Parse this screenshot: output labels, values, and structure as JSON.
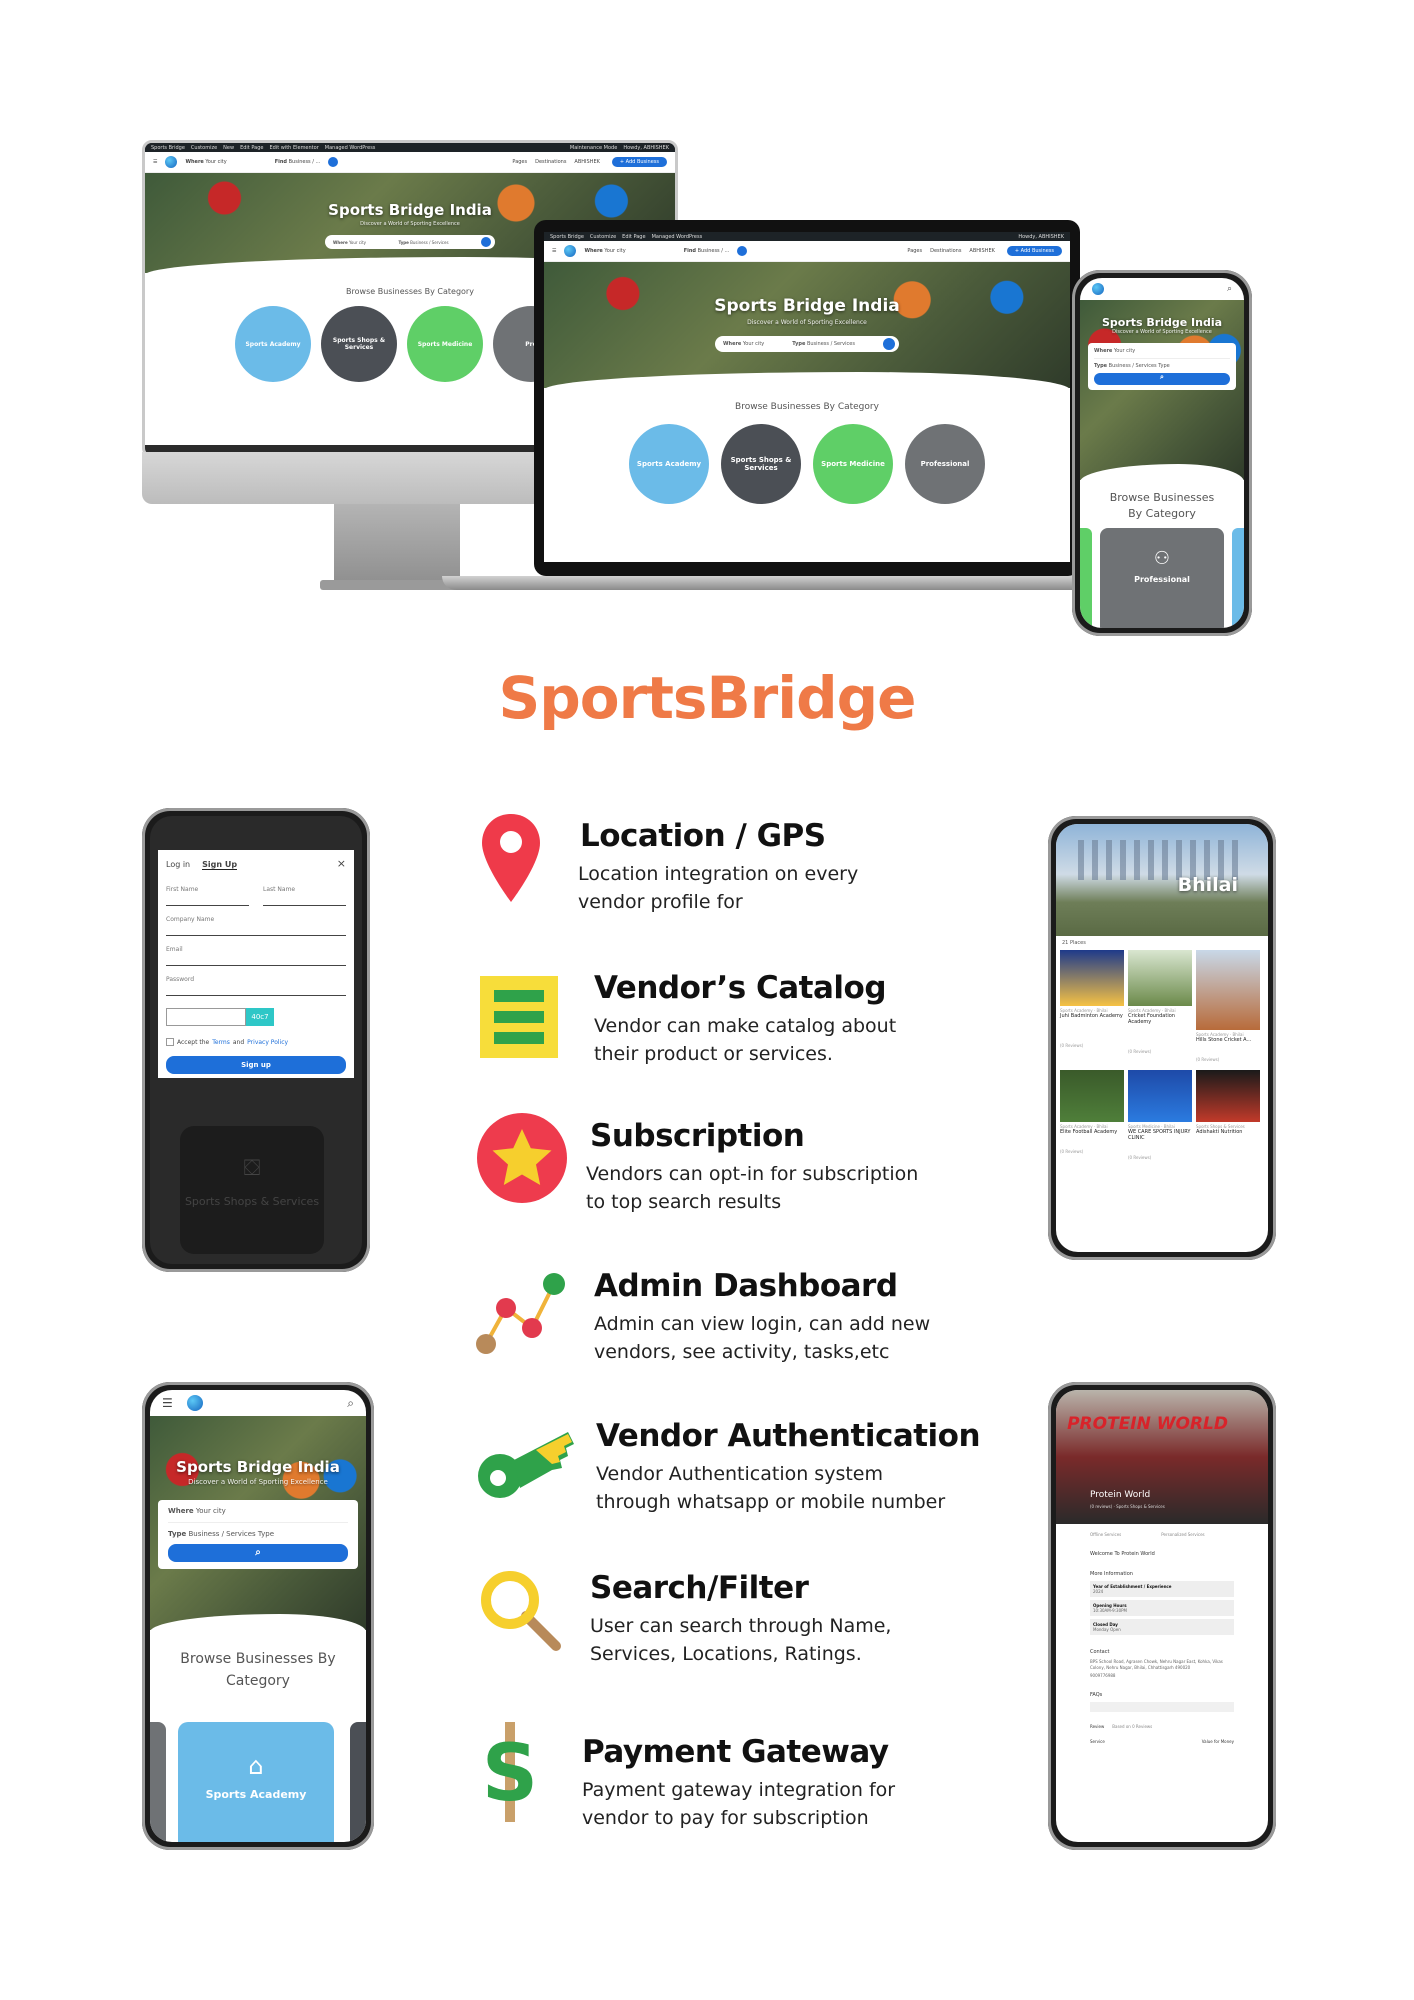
{
  "brand": "SportsBridge",
  "mockup": {
    "admin_bar": [
      "Sports Bridge",
      "Customize",
      "5",
      "New",
      "Edit Page",
      "Edit with Elementor",
      "Managed WordPress"
    ],
    "maintenance": "Maintenance Mode",
    "howdy": "Howdy, ABHISHEK",
    "where_label": "Where",
    "where_placeholder": "Your city",
    "find_label": "Find",
    "find_placeholder": "Business / ...",
    "pages": "Pages",
    "destinations": "Destinations",
    "user": "ABHISHEK",
    "add_business": "+ Add Business",
    "hero_title": "Sports Bridge India",
    "hero_subtitle": "Discover a World of Sporting Excellence",
    "type_label": "Type",
    "type_placeholder": "Business / Services",
    "type_placeholder_mobile": "Business / Services Type",
    "browse": "Browse Businesses By Category",
    "categories": [
      "Sports Academy",
      "Sports Shops & Services",
      "Sports Medicine",
      "Professional"
    ],
    "pro_short": "Pro"
  },
  "signup": {
    "tab_login": "Log in",
    "tab_signup": "Sign Up",
    "first_name": "First Name",
    "last_name": "Last Name",
    "company": "Company Name",
    "email": "Email",
    "password": "Password",
    "captcha": "40c7",
    "accept_prefix": "Accept the ",
    "terms": "Terms",
    "and": " and ",
    "privacy": "Privacy Policy",
    "button": "Sign up",
    "below_card": "Sports Shops & Services"
  },
  "city": {
    "name": "Bhilai",
    "count": "21 Places",
    "listings": [
      {
        "cat": "Sports Academy · Bhilai",
        "name": "Juhi Badminton Academy"
      },
      {
        "cat": "Sports Academy · Bhilai",
        "name": "Cricket Foundation Academy"
      },
      {
        "cat": "Sports Academy · Bhilai",
        "name": "Hills Stone Cricket A..."
      },
      {
        "cat": "Sports Academy · Bhilai",
        "name": "Elite Football Academy"
      },
      {
        "cat": "Sports Medicine · Bhilai",
        "name": "WE CARE SPORTS INJURY CLINIC"
      },
      {
        "cat": "Sports Shops & Services",
        "name": "Adishakti Nutrition"
      }
    ],
    "reviews": "(0 Reviews)"
  },
  "features": [
    {
      "title": "Location / GPS",
      "desc": "Location integration on every\nvendor profile for"
    },
    {
      "title": "Vendor’s Catalog",
      "desc": "Vendor can make catalog about\ntheir product or services."
    },
    {
      "title": "Subscription",
      "desc": "Vendors can opt-in for subscription\nto top search results"
    },
    {
      "title": "Admin Dashboard",
      "desc": "Admin can view login, can add new\nvendors, see activity, tasks,etc"
    },
    {
      "title": "Vendor Authentication",
      "desc": "Vendor Authentication system\nthrough whatsapp or mobile number"
    },
    {
      "title": "Search/Filter",
      "desc": "User can search through Name,\nServices, Locations, Ratings."
    },
    {
      "title": "Payment Gateway",
      "desc": "Payment gateway integration for\nvendor to pay for subscription"
    }
  ],
  "store": {
    "banner": "PROTEIN WORLD",
    "name": "Protein World",
    "meta": "(0 reviews) · Sports Shops & Services",
    "welcome": "Welcome To Protein World",
    "more_info": "More Information",
    "rows": [
      {
        "k": "Year of Establishment / Experience",
        "v": "2024"
      },
      {
        "k": "Opening Hours",
        "v": "10:30AM-9:30PM"
      },
      {
        "k": "Closed Day",
        "v": "Monday Open"
      }
    ],
    "contact": "Contact",
    "address": "BPS School Road, Agrasen Chowk, Nehru Nagar East, Kohka, Vikas Colony, Nehru Nagar, Bhilai, Chhattisgarh 490020",
    "phone": "9009776988",
    "faqs": "FAQs",
    "review": "Review",
    "stars": "Based on 0 Reviews",
    "service": "Service",
    "value": "Value for Money",
    "tabs": [
      "Offline Services",
      "Personalized Services"
    ]
  },
  "colors": {
    "brand": "#ef7a47",
    "primary": "#1e6fd9",
    "academy": "#6bbbe8",
    "shops": "#4b4f55",
    "medicine": "#5fcf67",
    "professional": "#6f7275"
  }
}
